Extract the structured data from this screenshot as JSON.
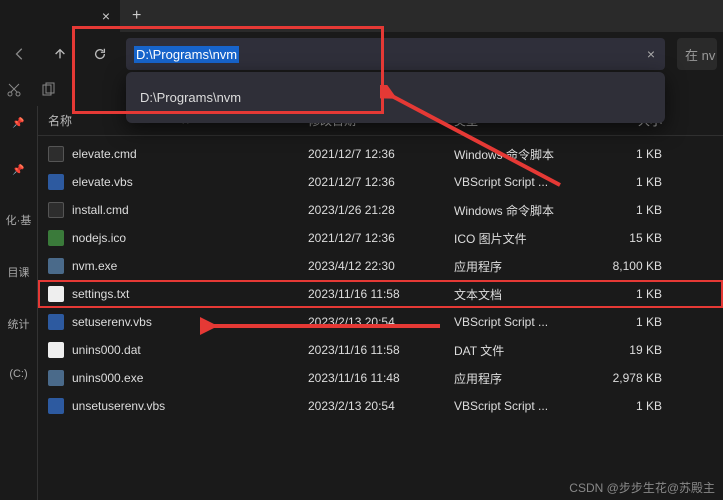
{
  "address": {
    "path": "D:\\Programs\\nvm",
    "suggestion": "D:\\Programs\\nvm",
    "clear": "×"
  },
  "search": {
    "prefix": "在 nv"
  },
  "tab": {
    "close": "×",
    "new": "+"
  },
  "headers": {
    "name": "名称",
    "date": "修改日期",
    "type": "类型",
    "size": "大小"
  },
  "sidebar": {
    "items": [
      "化·基",
      "目课",
      "统计",
      "(C:)"
    ]
  },
  "files": [
    {
      "name": "elevate.cmd",
      "date": "2021/12/7 12:36",
      "type": "Windows 命令脚本",
      "size": "1 KB",
      "icon": "cmd"
    },
    {
      "name": "elevate.vbs",
      "date": "2021/12/7 12:36",
      "type": "VBScript Script ...",
      "size": "1 KB",
      "icon": "vbs"
    },
    {
      "name": "install.cmd",
      "date": "2023/1/26 21:28",
      "type": "Windows 命令脚本",
      "size": "1 KB",
      "icon": "cmd"
    },
    {
      "name": "nodejs.ico",
      "date": "2021/12/7 12:36",
      "type": "ICO 图片文件",
      "size": "15 KB",
      "icon": "ico"
    },
    {
      "name": "nvm.exe",
      "date": "2023/4/12 22:30",
      "type": "应用程序",
      "size": "8,100 KB",
      "icon": "exe"
    },
    {
      "name": "settings.txt",
      "date": "2023/11/16 11:58",
      "type": "文本文档",
      "size": "1 KB",
      "icon": "txt",
      "highlight": true
    },
    {
      "name": "setuserenv.vbs",
      "date": "2023/2/13 20:54",
      "type": "VBScript Script ...",
      "size": "1 KB",
      "icon": "vbs"
    },
    {
      "name": "unins000.dat",
      "date": "2023/11/16 11:58",
      "type": "DAT 文件",
      "size": "19 KB",
      "icon": "dat"
    },
    {
      "name": "unins000.exe",
      "date": "2023/11/16 11:48",
      "type": "应用程序",
      "size": "2,978 KB",
      "icon": "exe"
    },
    {
      "name": "unsetuserenv.vbs",
      "date": "2023/2/13 20:54",
      "type": "VBScript Script ...",
      "size": "1 KB",
      "icon": "vbs"
    }
  ],
  "watermark": "CSDN @步步生花@苏殿主"
}
